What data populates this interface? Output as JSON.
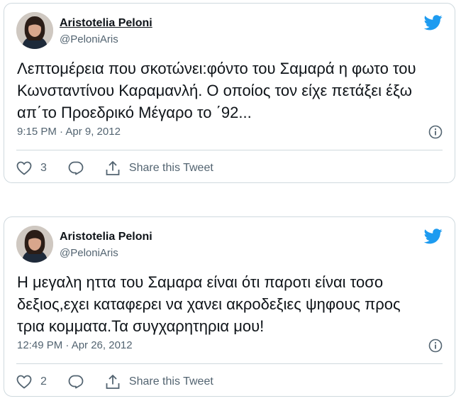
{
  "colors": {
    "twitter_blue": "#1d9bf0",
    "text_primary": "#0f1419",
    "text_secondary": "#536471",
    "border": "#cfd9de"
  },
  "tweets": [
    {
      "author_name": "Aristotelia Peloni",
      "author_handle": "@PeloniAris",
      "lines": [
        "Λεπτομέρεια που σκοτώνει:φόντο του Σαμαρά η φωτο του",
        "Κωνσταντίνου Καραμανλή. Ο οποίος τον είχε πετάξει έξω",
        "απ΄το Προεδρικό Μέγαρο το ΄92..."
      ],
      "time": "9:15 PM",
      "date": "Apr 9, 2012",
      "timestamp": "9:15 PM · Apr 9, 2012",
      "likes": "3",
      "share_label": "Share this Tweet",
      "icons": [
        "avatar",
        "twitter-bird-icon",
        "info-icon",
        "heart-icon",
        "reply-icon",
        "share-icon"
      ]
    },
    {
      "author_name": "Aristotelia Peloni",
      "author_handle": "@PeloniAris",
      "lines": [
        "Η μεγαλη ηττα του Σαμαρα είναι ότι παροτι είναι τοσο",
        "δεξιος,εχει καταφερει να χανει ακροδεξιες ψηφους προς",
        "τρια κομματα.Τα συγχαρητηρια μου!"
      ],
      "time": "12:49 PM",
      "date": "Apr 26, 2012",
      "timestamp": "12:49 PM · Apr 26, 2012",
      "likes": "2",
      "share_label": "Share this Tweet",
      "icons": [
        "avatar",
        "twitter-bird-icon",
        "info-icon",
        "heart-icon",
        "reply-icon",
        "share-icon"
      ]
    }
  ]
}
